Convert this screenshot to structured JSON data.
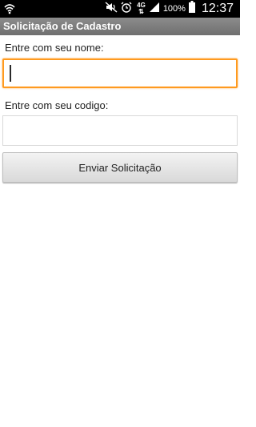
{
  "status_bar": {
    "network_type": "4G",
    "battery_percent": "100%",
    "time": "12:37",
    "icons": [
      "wifi-icon",
      "mute-icon",
      "alarm-icon",
      "signal-icon",
      "battery-icon"
    ]
  },
  "app": {
    "title": "Solicitação de Cadastro"
  },
  "form": {
    "name_label": "Entre com seu nome:",
    "name_value": "",
    "code_label": "Entre com seu codigo:",
    "code_value": "",
    "submit_label": "Enviar Solicitação"
  },
  "colors": {
    "status_bar": "#000000",
    "title_bar": "#7a7a7a",
    "focus_border": "#ff9a1f"
  }
}
